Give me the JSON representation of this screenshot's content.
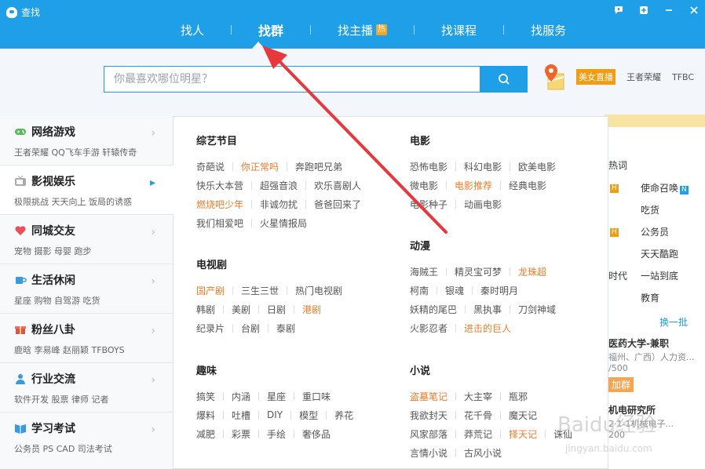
{
  "window": {
    "title": "查找"
  },
  "nav": {
    "tabs": [
      {
        "label": "找人"
      },
      {
        "label": "找群"
      },
      {
        "label": "找主播",
        "badge": "热"
      },
      {
        "label": "找课程"
      },
      {
        "label": "找服务"
      }
    ],
    "active_tab": "找群"
  },
  "search": {
    "placeholder": "你最喜欢哪位明星？"
  },
  "hot_tags": {
    "badge": "美女直播",
    "items": [
      "王者荣耀",
      "TFBC"
    ]
  },
  "sidebar": {
    "items": [
      {
        "title": "网络游戏",
        "sub": "王者荣耀  QQ飞车手游  轩辕传奇",
        "icon": "gamepad-icon"
      },
      {
        "title": "影视娱乐",
        "sub": "极限挑战  天天向上  饭局的诱惑",
        "icon": "tv-icon"
      },
      {
        "title": "同城交友",
        "sub": "宠物  摄影  母婴  跑步",
        "icon": "heart-icon"
      },
      {
        "title": "生活休闲",
        "sub": "星座  购物  自驾游  吃货",
        "icon": "cup-icon"
      },
      {
        "title": "粉丝八卦",
        "sub": "鹿晗  李易峰  赵丽颖  TFBOYS",
        "icon": "gift-icon"
      },
      {
        "title": "行业交流",
        "sub": "软件开发  股票  律师  记者",
        "icon": "person-icon"
      },
      {
        "title": "学习考试",
        "sub": "公务员  PS  CAD  司法考试",
        "icon": "book-icon"
      }
    ]
  },
  "groups": {
    "variety": {
      "title": "综艺节目",
      "rows": [
        [
          {
            "t": "奇葩说"
          },
          {
            "t": "你正常吗",
            "hl": true
          },
          {
            "t": "奔跑吧兄弟"
          }
        ],
        [
          {
            "t": "快乐大本营"
          },
          {
            "t": "超强音浪"
          },
          {
            "t": "欢乐喜剧人"
          }
        ],
        [
          {
            "t": "燃烧吧少年",
            "hl": true
          },
          {
            "t": "非诚勿扰"
          },
          {
            "t": "爸爸回来了"
          }
        ],
        [
          {
            "t": "我们相爱吧"
          },
          {
            "t": "火星情报局"
          }
        ]
      ]
    },
    "movie": {
      "title": "电影",
      "rows": [
        [
          {
            "t": "恐怖电影"
          },
          {
            "t": "科幻电影"
          },
          {
            "t": "欧美电影"
          }
        ],
        [
          {
            "t": "微电影"
          },
          {
            "t": "电影推荐",
            "hl": true
          },
          {
            "t": "经典电影"
          }
        ],
        [
          {
            "t": "电影种子"
          },
          {
            "t": "动画电影"
          }
        ]
      ]
    },
    "tv": {
      "title": "电视剧",
      "rows": [
        [
          {
            "t": "国产剧",
            "hl": true
          },
          {
            "t": "三生三世"
          },
          {
            "t": "热门电视剧"
          }
        ],
        [
          {
            "t": "韩剧"
          },
          {
            "t": "美剧"
          },
          {
            "t": "日剧"
          },
          {
            "t": "港剧",
            "hl": true
          }
        ],
        [
          {
            "t": "纪录片"
          },
          {
            "t": "台剧"
          },
          {
            "t": "泰剧"
          }
        ]
      ]
    },
    "anime": {
      "title": "动漫",
      "rows": [
        [
          {
            "t": "海贼王"
          },
          {
            "t": "精灵宝可梦"
          },
          {
            "t": "龙珠超",
            "hl": true
          }
        ],
        [
          {
            "t": "柯南"
          },
          {
            "t": "银魂"
          },
          {
            "t": "秦时明月"
          }
        ],
        [
          {
            "t": "妖精的尾巴"
          },
          {
            "t": "黑执事"
          },
          {
            "t": "刀剑神域"
          }
        ],
        [
          {
            "t": "火影忍者"
          },
          {
            "t": "进击的巨人",
            "hl": true
          }
        ]
      ]
    },
    "fun": {
      "title": "趣味",
      "rows": [
        [
          {
            "t": "搞笑"
          },
          {
            "t": "内涵"
          },
          {
            "t": "星座"
          },
          {
            "t": "重口味"
          }
        ],
        [
          {
            "t": "爆料"
          },
          {
            "t": "吐槽"
          },
          {
            "t": "DIY"
          },
          {
            "t": "模型"
          },
          {
            "t": "养花"
          }
        ],
        [
          {
            "t": "减肥"
          },
          {
            "t": "彩票"
          },
          {
            "t": "手绘"
          },
          {
            "t": "奢侈品"
          }
        ]
      ]
    },
    "novel": {
      "title": "小说",
      "rows": [
        [
          {
            "t": "盗墓笔记",
            "hl": true
          },
          {
            "t": "大主宰"
          },
          {
            "t": "瓶邪"
          }
        ],
        [
          {
            "t": "我欲封天"
          },
          {
            "t": "花千骨"
          },
          {
            "t": "魔天记"
          }
        ],
        [
          {
            "t": "风家部落"
          },
          {
            "t": "莽荒记"
          },
          {
            "t": "择天记",
            "hl": true
          },
          {
            "t": "诛仙"
          }
        ],
        [
          {
            "t": "言情小说"
          },
          {
            "t": "古风小说"
          }
        ]
      ]
    }
  },
  "right_panel": {
    "items": [
      {
        "t": "热词"
      },
      {
        "t": "使命召唤",
        "badge": "N"
      },
      {
        "t": "吃货"
      },
      {
        "t": "公务员"
      },
      {
        "t": "天天酷跑"
      },
      {
        "t": "时代"
      },
      {
        "t": "一站到底"
      },
      {
        "t": "教育"
      },
      {
        "t": "换一批"
      },
      {
        "t": "医药大学-兼职"
      },
      {
        "t": "福州、广西）人力资..."
      },
      {
        "t": "/500"
      },
      {
        "t": "加群"
      },
      {
        "t": "机电研究所"
      },
      {
        "t": "2·1-1机械电子..."
      },
      {
        "t": "200"
      }
    ],
    "badge_h": "H"
  },
  "watermark": {
    "brand": "Baidu经验",
    "url": "jingyan.baidu.com"
  },
  "colors": {
    "primary": "#1e9fe8",
    "highlight": "#f07b27",
    "arrow": "#e8383d"
  }
}
